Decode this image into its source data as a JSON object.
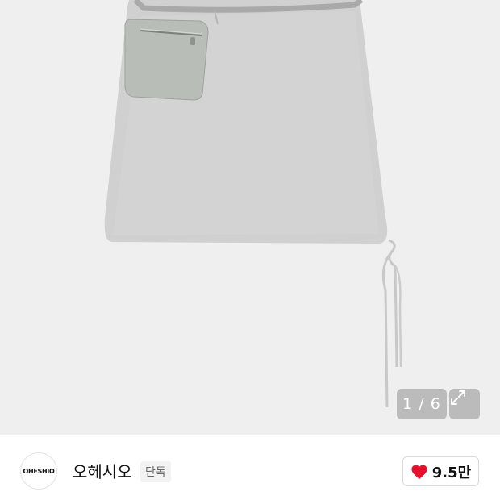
{
  "gallery": {
    "image_alt": "product-skirt-image",
    "counter": "1 / 6",
    "expand_icon": "expand-arrows-icon"
  },
  "brand": {
    "logo_text": "OHESHIO",
    "name": "오헤시오",
    "badge": "단독"
  },
  "like": {
    "icon": "heart-icon",
    "count": "9.5만",
    "icon_color": "#e8112d"
  }
}
